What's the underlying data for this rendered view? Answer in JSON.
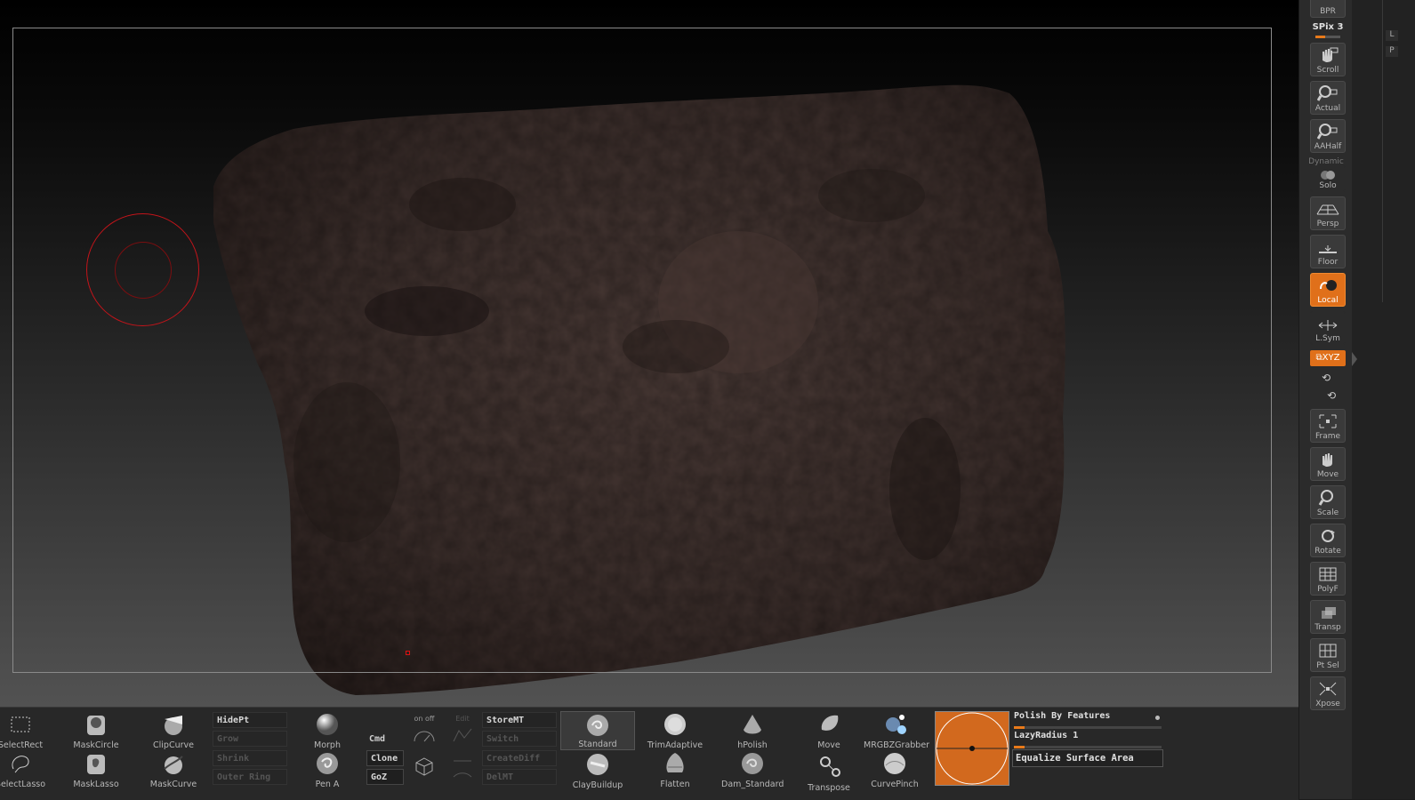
{
  "right_shelf": {
    "bpr": "BPR",
    "spix": "SPix 3",
    "spix_level": 0.4,
    "buttons": {
      "scroll": "Scroll",
      "actual": "Actual",
      "aahalf": "AAHalf",
      "dynamic": "Dynamic",
      "solo": "Solo",
      "persp": "Persp",
      "floor": "Floor",
      "local": "Local",
      "lsym": "L.Sym",
      "xyz": "⧉XYZ",
      "frame": "Frame",
      "move": "Move",
      "scale": "Scale",
      "rotate": "Rotate",
      "polyf": "PolyF",
      "transp": "Transp",
      "ptsel": "Pt Sel",
      "xpose": "Xpose"
    }
  },
  "side_strip": {
    "tab1": "L",
    "tab2": "P"
  },
  "bottom_shelf": {
    "select_rect": "SelectRect",
    "select_lasso": "SelectLasso",
    "mask_circle": "MaskCircle",
    "mask_lasso": "MaskLasso",
    "clip_curve": "ClipCurve",
    "mask_curve": "MaskCurve",
    "hidept": "HidePt",
    "grow": "Grow",
    "shrink": "Shrink",
    "outer_ring": "Outer Ring",
    "morph": "Morph",
    "pen_a": "Pen A",
    "cmd": "Cmd",
    "clone": "Clone",
    "goz": "GoZ",
    "onoff": "on off",
    "edit": "Edit",
    "storemt": "StoreMT",
    "switch": "Switch",
    "creatediff": "CreateDiff Me",
    "delmt": "DelMT",
    "brushes": {
      "standard": "Standard",
      "claybuildup": "ClayBuildup",
      "trimadaptive": "TrimAdaptive",
      "flatten": "Flatten",
      "hpolish": "hPolish",
      "dam_standard": "Dam_Standard",
      "move": "Move",
      "transpose": "Transpose",
      "mrgbzgrabber": "MRGBZGrabber",
      "curvepinch": "CurvePinch"
    },
    "polish_by_features": "Polish By Features",
    "polish_level": 0.07,
    "lazy_radius": "LazyRadius 1",
    "lazy_level": 0.07,
    "equalize": "Equalize Surface Area"
  }
}
